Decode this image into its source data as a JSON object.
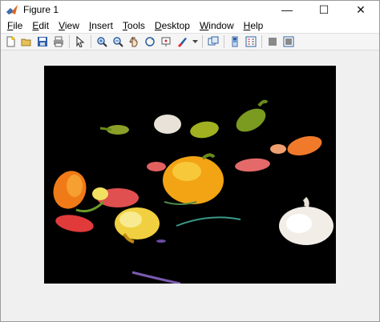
{
  "window": {
    "title": "Figure 1",
    "controls": {
      "minimize": "—",
      "maximize": "☐",
      "close": "✕"
    }
  },
  "menu": [
    {
      "label_ul": "F",
      "label_rest": "ile"
    },
    {
      "label_ul": "E",
      "label_rest": "dit"
    },
    {
      "label_ul": "V",
      "label_rest": "iew"
    },
    {
      "label_ul": "I",
      "label_rest": "nsert"
    },
    {
      "label_ul": "T",
      "label_rest": "ools"
    },
    {
      "label_ul": "D",
      "label_rest": "esktop"
    },
    {
      "label_ul": "W",
      "label_rest": "indow"
    },
    {
      "label_ul": "H",
      "label_rest": "elp"
    }
  ],
  "toolbar": {
    "icons": [
      "new-figure-icon",
      "open-file-icon",
      "save-icon",
      "print-icon",
      "pointer-icon",
      "zoom-in-icon",
      "zoom-out-icon",
      "pan-icon",
      "rotate-3d-icon",
      "data-cursor-icon",
      "brush-icon",
      "link-plot-icon",
      "colorbar-icon",
      "legend-icon",
      "hide-plot-tools-icon",
      "show-plot-tools-icon"
    ]
  },
  "colors": {
    "titlebar": "#ffffff",
    "menubar": "#ffffff",
    "figure_bg": "#f0f0f0",
    "axes_bg": "#000000"
  },
  "image": {
    "description_tag": "segmented-vegetables-image"
  }
}
